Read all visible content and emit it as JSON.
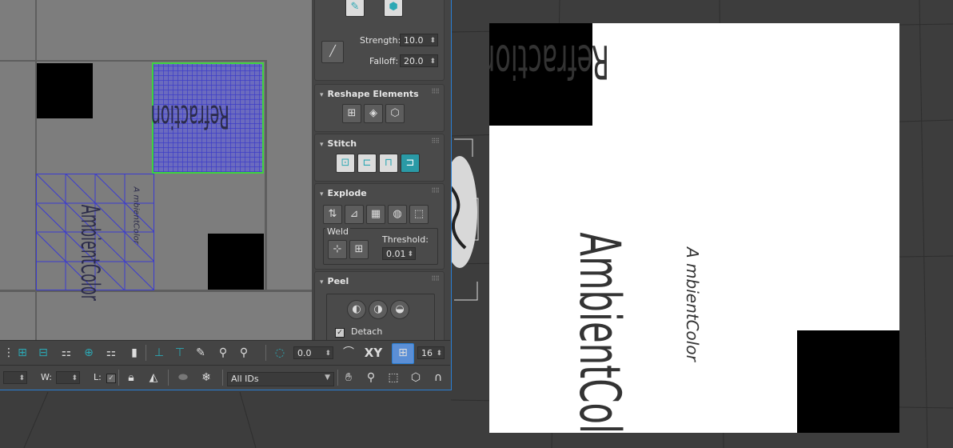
{
  "uv_canvas": {
    "texts": {
      "refraction": "Refraction",
      "ambient_big": "AmbientColor",
      "ambient_small": "A mbientColor"
    }
  },
  "panel": {
    "brush": {
      "strength_label": "Strength:",
      "strength_value": "10.0",
      "falloff_label": "Falloff:",
      "falloff_value": "20.0"
    },
    "rollouts": {
      "reshape": "Reshape Elements",
      "stitch": "Stitch",
      "explode": "Explode",
      "peel": "Peel"
    },
    "weld": {
      "label": "Weld",
      "threshold_label": "Threshold:",
      "threshold_value": "0.01"
    },
    "peel": {
      "detach_label": "Detach",
      "detach_checked": true
    }
  },
  "toolbar1": {
    "rotation_value": "0.0",
    "xy_label": "XY",
    "snap_value": "16"
  },
  "toolbar2": {
    "w_label": "W:",
    "l_label": "L:",
    "id_select": "All IDs"
  },
  "viewport": {
    "refraction": "Refraction",
    "ambient_big": "AmbientColor",
    "ambient_small": "A mbientColor"
  },
  "colors": {
    "accent_blue": "#2a7fd4",
    "selection_green": "#3fd23f",
    "uv_mesh": "#3b3bd0",
    "teal": "#2ca8b4"
  }
}
